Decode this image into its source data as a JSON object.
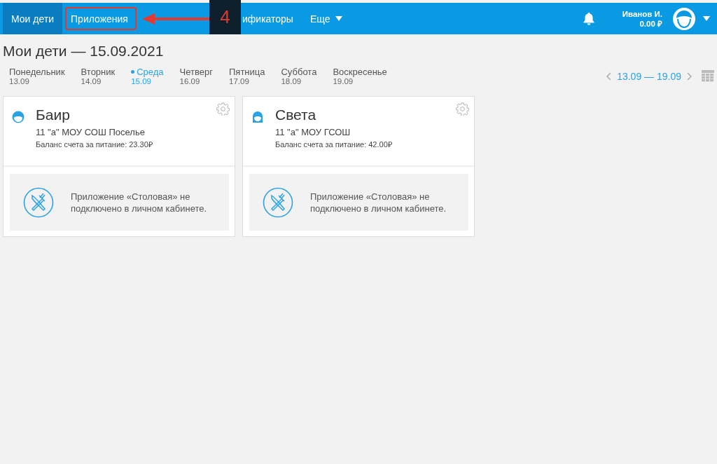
{
  "nav": {
    "items": [
      {
        "label": "Мои дети",
        "selected": true,
        "highlighted": false
      },
      {
        "label": "Приложения",
        "selected": false,
        "highlighted": true
      },
      {
        "label": "ификаторы",
        "selected": false,
        "highlighted": false
      }
    ],
    "more": "Еще",
    "user": {
      "name": "Иванов И.",
      "balance": "0.00 ₽"
    }
  },
  "annotation": {
    "step": "4"
  },
  "page_title": "Мои дети — 15.09.2021",
  "days": [
    {
      "name": "Понедельник",
      "date": "13.09",
      "selected": false
    },
    {
      "name": "Вторник",
      "date": "14.09",
      "selected": false
    },
    {
      "name": "Среда",
      "date": "15.09",
      "selected": true
    },
    {
      "name": "Четверг",
      "date": "16.09",
      "selected": false
    },
    {
      "name": "Пятница",
      "date": "17.09",
      "selected": false
    },
    {
      "name": "Суббота",
      "date": "18.09",
      "selected": false
    },
    {
      "name": "Воскресенье",
      "date": "19.09",
      "selected": false
    }
  ],
  "week_range": "13.09 — 19.09",
  "children": [
    {
      "name": "Баир",
      "kind": "boy",
      "school": "11 \"а\" МОУ СОШ Поселье",
      "balance": "Баланс счета за питание: 23.30₽",
      "notice": "Приложение «Столовая» не подключено в личном кабинете."
    },
    {
      "name": "Света",
      "kind": "girl",
      "school": "11 \"а\" МОУ ГСОШ",
      "balance": "Баланс счета за питание: 42.00₽",
      "notice": "Приложение «Столовая» не подключено в личном кабинете."
    }
  ]
}
